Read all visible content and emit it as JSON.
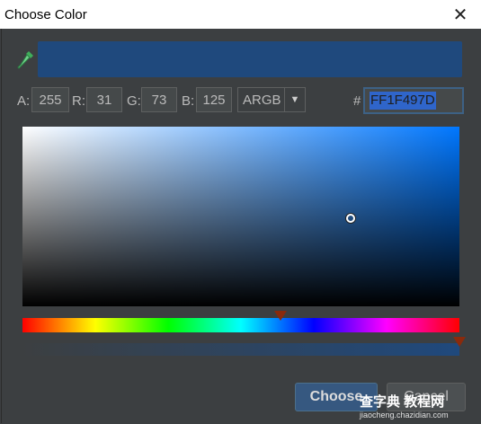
{
  "window": {
    "title": "Choose Color",
    "close_glyph": "✕"
  },
  "color": {
    "preview_hex": "#1F497D"
  },
  "fields": {
    "a_label": "A:",
    "a_value": "255",
    "r_label": "R:",
    "r_value": "31",
    "g_label": "G:",
    "g_value": "73",
    "b_label": "B:",
    "b_value": "125",
    "mode_value": "ARGB",
    "mode_arrow": "▼",
    "hex_label": "#",
    "hex_value": "FF1F497D"
  },
  "sliders": {
    "hue_position": 0.59,
    "alpha_position": 1.0
  },
  "buttons": {
    "choose_label": "Choose",
    "cancel_label": "Cancel"
  },
  "watermark": {
    "line1": "查字典 教程网",
    "line2": "jiaocheng.chazidian.com"
  },
  "icons": {
    "pipette": "eyedropper-icon",
    "close": "close-icon",
    "dropdown": "chevron-down-icon"
  }
}
